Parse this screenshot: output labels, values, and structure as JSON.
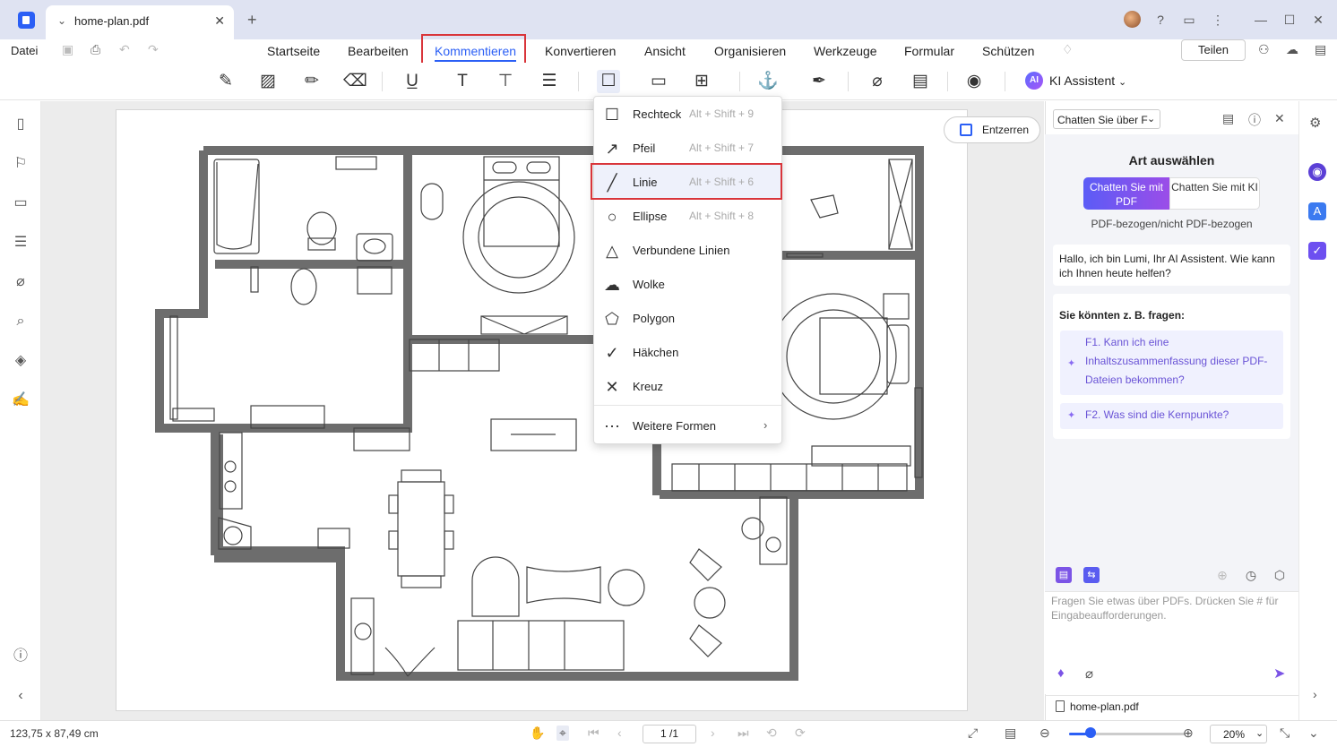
{
  "tab": {
    "title": "home-plan.pdf"
  },
  "menubar": {
    "file": "Datei",
    "items": [
      "Startseite",
      "Bearbeiten",
      "Kommentieren",
      "Konvertieren",
      "Ansicht",
      "Organisieren",
      "Werkzeuge",
      "Formular",
      "Schützen"
    ],
    "active": "Kommentieren",
    "share": "Teilen"
  },
  "toolbar": {
    "ai_assistant": "KI Assistent",
    "ai_badge": "AI"
  },
  "canvas": {
    "dewarp_button": "Entzerren"
  },
  "shape_menu": {
    "items": [
      {
        "label": "Rechteck",
        "shortcut": "Alt + Shift + 9",
        "icon": "rectangle-icon"
      },
      {
        "label": "Pfeil",
        "shortcut": "Alt + Shift + 7",
        "icon": "arrow-icon"
      },
      {
        "label": "Linie",
        "shortcut": "Alt + Shift + 6",
        "icon": "line-icon"
      },
      {
        "label": "Ellipse",
        "shortcut": "Alt + Shift + 8",
        "icon": "ellipse-icon"
      },
      {
        "label": "Verbundene Linien",
        "shortcut": "",
        "icon": "polyline-icon"
      },
      {
        "label": "Wolke",
        "shortcut": "",
        "icon": "cloud-icon"
      },
      {
        "label": "Polygon",
        "shortcut": "",
        "icon": "polygon-icon"
      },
      {
        "label": "Häkchen",
        "shortcut": "",
        "icon": "checkmark-icon"
      },
      {
        "label": "Kreuz",
        "shortcut": "",
        "icon": "cross-icon"
      }
    ],
    "more": "Weitere Formen",
    "highlighted": "Linie"
  },
  "ai_panel": {
    "select_label": "Chatten Sie über F",
    "heading": "Art auswählen",
    "mode_pdf": "Chatten Sie mit PDF",
    "mode_ki": "Chatten Sie mit KI",
    "mode_sub": "PDF-bezogen/nicht PDF-bezogen",
    "greeting": "Hallo, ich bin Lumi, Ihr AI Assistent. Wie kann ich Ihnen heute helfen?",
    "suggest_title": "Sie könnten z. B. fragen:",
    "questions": [
      "F1. Kann ich eine Inhaltszusammenfassung dieser PDF-Dateien bekommen?",
      "F2. Was sind die Kernpunkte?"
    ],
    "input_placeholder": "Fragen Sie etwas über PDFs. Drücken Sie # für Eingabeaufforderungen.",
    "file": "home-plan.pdf"
  },
  "status": {
    "coords": "123,75 x 87,49 cm",
    "page": "1 /1",
    "zoom": "20%",
    "zoom_slider_fraction": 0.2
  },
  "colors": {
    "accent": "#2b5ff5",
    "highlight": "#d9353a",
    "ai_purple": "#7b54e6"
  }
}
